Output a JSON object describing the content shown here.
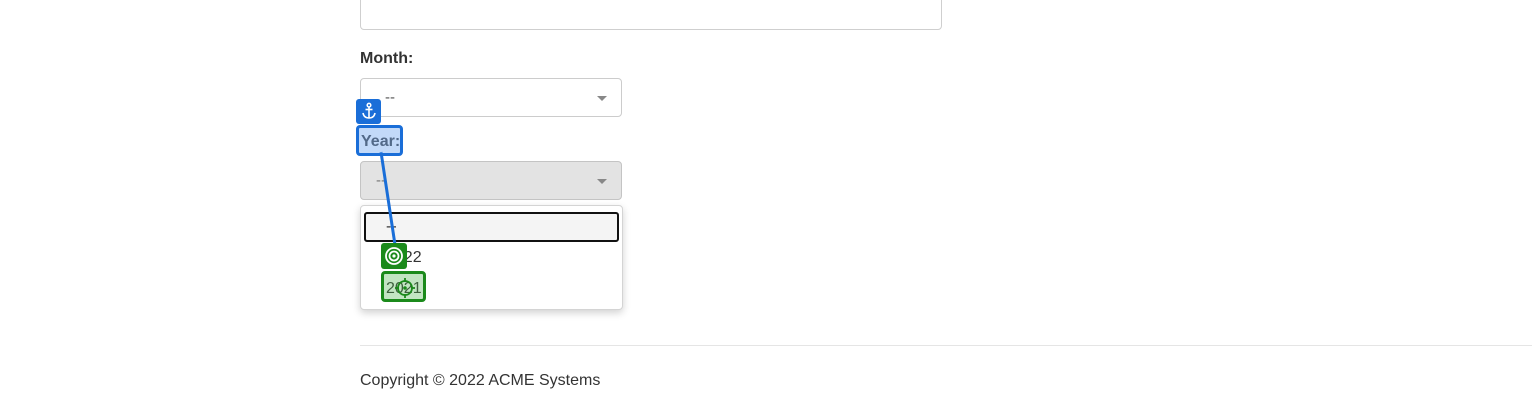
{
  "form": {
    "month_label": "Month:",
    "month_value": "--",
    "year_label": "Year:",
    "year_value": "--"
  },
  "dropdown": {
    "options": [
      "--",
      "2022",
      "2021"
    ],
    "focused_option": "--"
  },
  "footer": {
    "copyright": "Copyright © 2022 ACME Systems"
  },
  "colors": {
    "annotation_blue": "#1a6ed8",
    "annotation_green": "#1b8a1b"
  },
  "icons": {
    "anchor": "anchor-icon",
    "target": "target-icon",
    "crosshair": "crosshair-icon"
  }
}
